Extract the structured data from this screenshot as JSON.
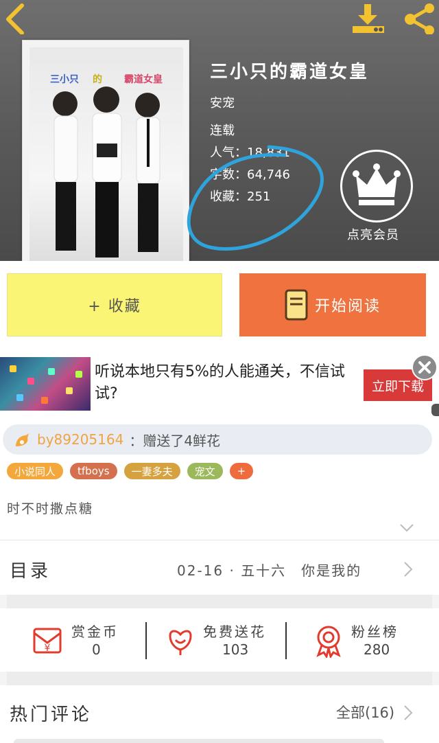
{
  "book": {
    "title": "三小只的霸道女皇",
    "author": "安宠",
    "status": "连载",
    "popularity_label": "人气：",
    "popularity": "18,831",
    "words_label": "字数：",
    "words": "64,746",
    "favorites_label": "收藏：",
    "favorites": "251",
    "cover_words": [
      "三小只",
      "的",
      "霸道女皇"
    ],
    "vip_label": "点亮会员"
  },
  "actions": {
    "favorite_label": "+ 收藏",
    "read_label": "开始阅读"
  },
  "ad": {
    "text": "听说本地只有5%的人能通关，不信试试?",
    "button": "立即下载"
  },
  "gift": {
    "user": "by89205164",
    "text": "：赠送了4鲜花"
  },
  "tags": [
    {
      "label": "小说同人",
      "color": "#f4a73b"
    },
    {
      "label": "tfboys",
      "color": "#d4704d"
    },
    {
      "label": "一妻多夫",
      "color": "#d6a13f"
    },
    {
      "label": "宠文",
      "color": "#9bb95a"
    },
    {
      "label": "+",
      "color": "#ee6b3e"
    }
  ],
  "description": "时不时撒点糖",
  "catalog": {
    "title": "目录",
    "latest": "02-16 · 五十六　你是我的"
  },
  "stats": [
    {
      "label": "赏金币",
      "value": "0",
      "icon": "red-envelope-icon"
    },
    {
      "label": "免费送花",
      "value": "103",
      "icon": "flower-icon"
    },
    {
      "label": "粉丝榜",
      "value": "280",
      "icon": "medal-icon"
    }
  ],
  "comments": {
    "title": "热门评论",
    "all": "全部(16)"
  },
  "colors": {
    "accent_yellow": "#fbf575",
    "accent_orange": "#f0733f",
    "ad_red": "#d83a3a",
    "icon_red": "#e23b2e",
    "icon_gold": "#f2c230",
    "annotation_blue": "#2fa3dc"
  }
}
